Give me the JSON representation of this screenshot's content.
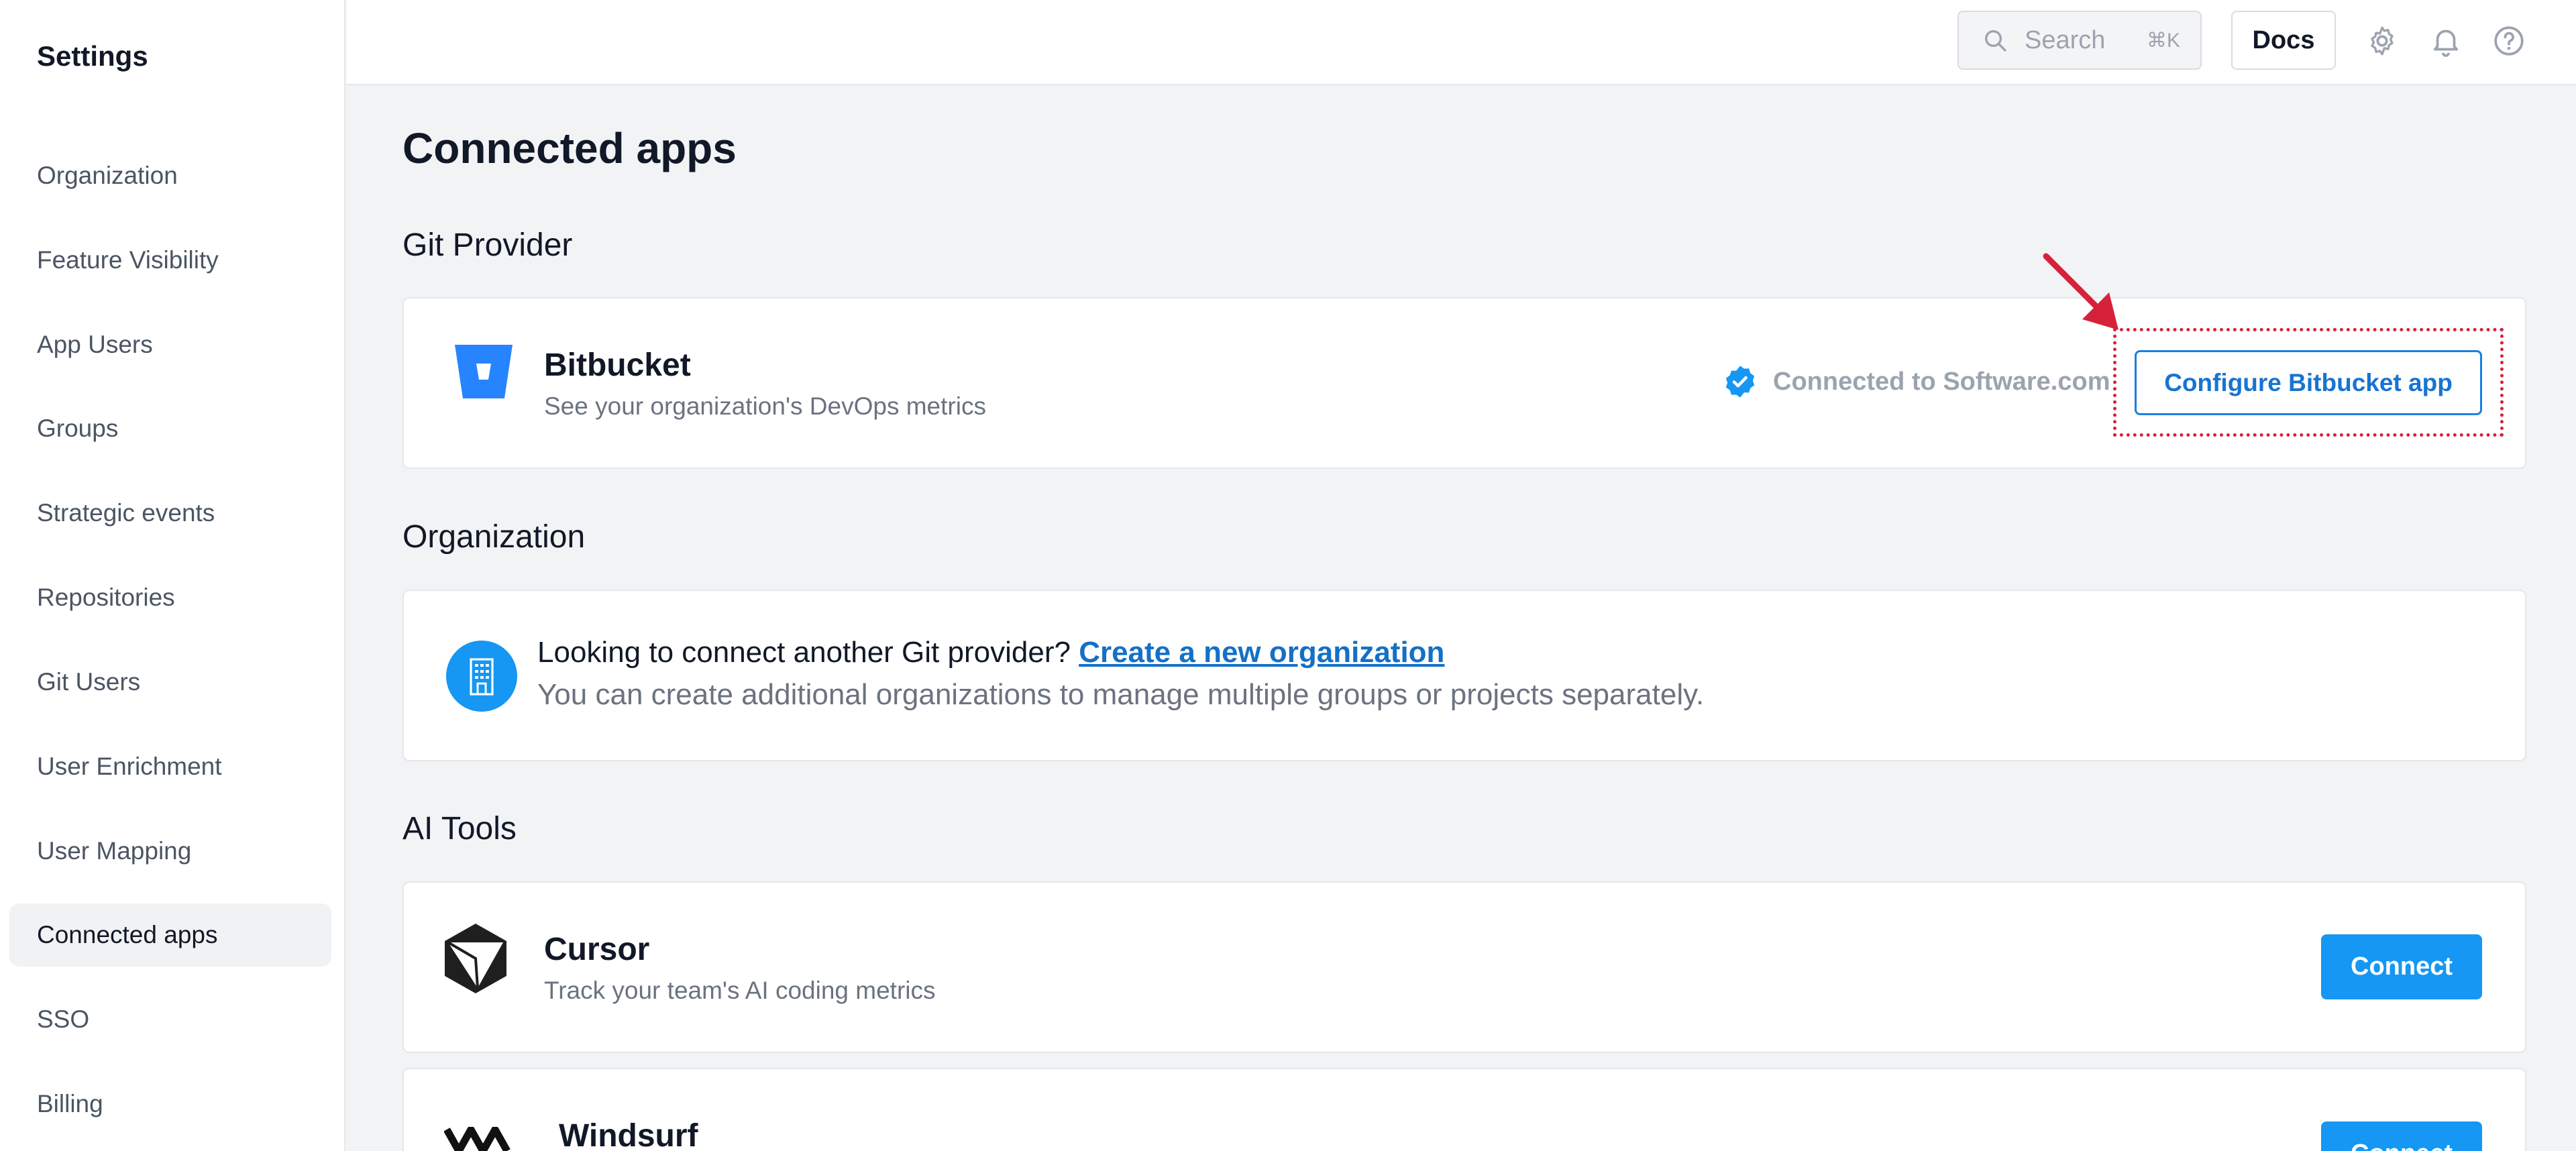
{
  "sidebar": {
    "title": "Settings",
    "items": [
      {
        "label": "Organization"
      },
      {
        "label": "Feature Visibility"
      },
      {
        "label": "App Users"
      },
      {
        "label": "Groups"
      },
      {
        "label": "Strategic events"
      },
      {
        "label": "Repositories"
      },
      {
        "label": "Git Users"
      },
      {
        "label": "User Enrichment"
      },
      {
        "label": "User Mapping"
      },
      {
        "label": "Connected apps",
        "active": true
      },
      {
        "label": "SSO"
      },
      {
        "label": "Billing"
      }
    ]
  },
  "topbar": {
    "search_placeholder": "Search",
    "search_shortcut": "⌘K",
    "docs_label": "Docs",
    "icons": [
      "gear-icon",
      "bell-icon",
      "help-icon"
    ]
  },
  "main": {
    "title": "Connected apps",
    "sections": {
      "git_provider": "Git Provider",
      "organization": "Organization",
      "ai_tools": "AI Tools"
    },
    "bitbucket": {
      "name": "Bitbucket",
      "description": "See your organization's DevOps metrics",
      "status": "Connected to Software.com",
      "button": "Configure Bitbucket app"
    },
    "org_card": {
      "prompt": "Looking to connect another Git provider?",
      "link": "Create a new organization",
      "description": "You can create additional organizations to manage multiple groups or projects separately."
    },
    "cursor": {
      "name": "Cursor",
      "description": "Track your team's AI coding metrics",
      "button": "Connect"
    },
    "windsurf": {
      "name": "Windsurf",
      "button": "Connect"
    }
  },
  "colors": {
    "accent": "#1597f3",
    "link": "#1470c7",
    "annotation": "#d6213a",
    "bitbucket": "#2684ff"
  }
}
